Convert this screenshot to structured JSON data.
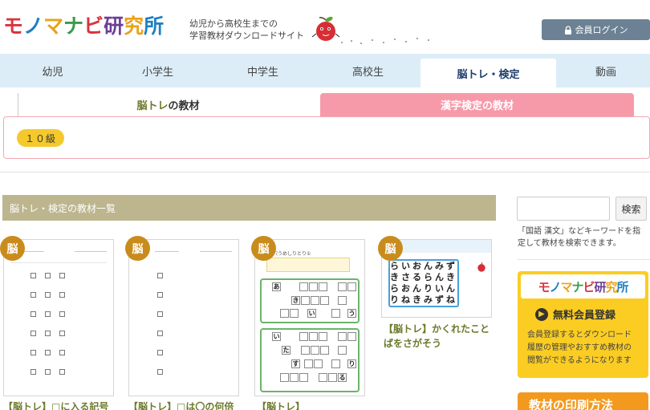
{
  "header": {
    "logo_chars": [
      "モ",
      "ノ",
      "マ",
      "ナ",
      "ビ",
      "研",
      "究",
      "所"
    ],
    "logo_colors": [
      "#d8343e",
      "#1f7fc4",
      "#e8a21a",
      "#3a9a4a",
      "#d8343e",
      "#6b3f94",
      "#e8a21a",
      "#1f7fc4"
    ],
    "tagline_line1": "幼児から高校生までの",
    "tagline_line2": "学習教材ダウンロードサイト",
    "login_label": "会員ログイン"
  },
  "nav": {
    "items": [
      "幼児",
      "小学生",
      "中学生",
      "高校生",
      "脳トレ・検定",
      "動画"
    ],
    "active_index": 4
  },
  "subtabs": {
    "left_part1": "脳トレ",
    "left_part2": "の教材",
    "right": "漢字検定の教材"
  },
  "level": {
    "label": "１０級"
  },
  "list": {
    "header": "脳トレ・検定の教材一覧",
    "badge": "脳",
    "cards": [
      {
        "title_line1": "【脳トレ】□に入る記号"
      },
      {
        "title_line1": "【脳トレ】□は〇の何倍"
      },
      {
        "title_line1": "【脳トレ】"
      },
      {
        "title_line1": "【脳トレ】かくれたこと",
        "title_line2": "ばをさがそう"
      }
    ]
  },
  "sidebar": {
    "search_placeholder": "",
    "search_button": "検索",
    "search_note": "「国語 漢文」などキーワードを指定して教材を検索できます。",
    "promo_logo_chars": [
      "モ",
      "ノ",
      "マ",
      "ナ",
      "ビ",
      "研",
      "究",
      "所"
    ],
    "promo_title": "無料会員登録",
    "promo_text_line1": "会員登録するとダウンロード",
    "promo_text_line2": "履歴の管理やおすすめ教材の",
    "promo_text_line3": "閲覧ができるようになります",
    "orange_button": "教材の印刷方法"
  },
  "worksheets": {
    "card3_title": "穴うめしりとり①",
    "card3_row1": [
      "あ",
      "き",
      "い",
      "う"
    ],
    "card3_row2": [
      "い",
      "た",
      "す",
      "り",
      "る"
    ],
    "card4_grid": [
      [
        "ら",
        "い",
        "お",
        "ん",
        "み",
        "ず"
      ],
      [
        "き",
        "さ",
        "る",
        "ら",
        "ん",
        "き"
      ],
      [
        "ら",
        "お",
        "ん",
        "り",
        "い",
        "ん"
      ],
      [
        "り",
        "ね",
        "き",
        "み",
        "ず",
        "ね"
      ]
    ]
  }
}
